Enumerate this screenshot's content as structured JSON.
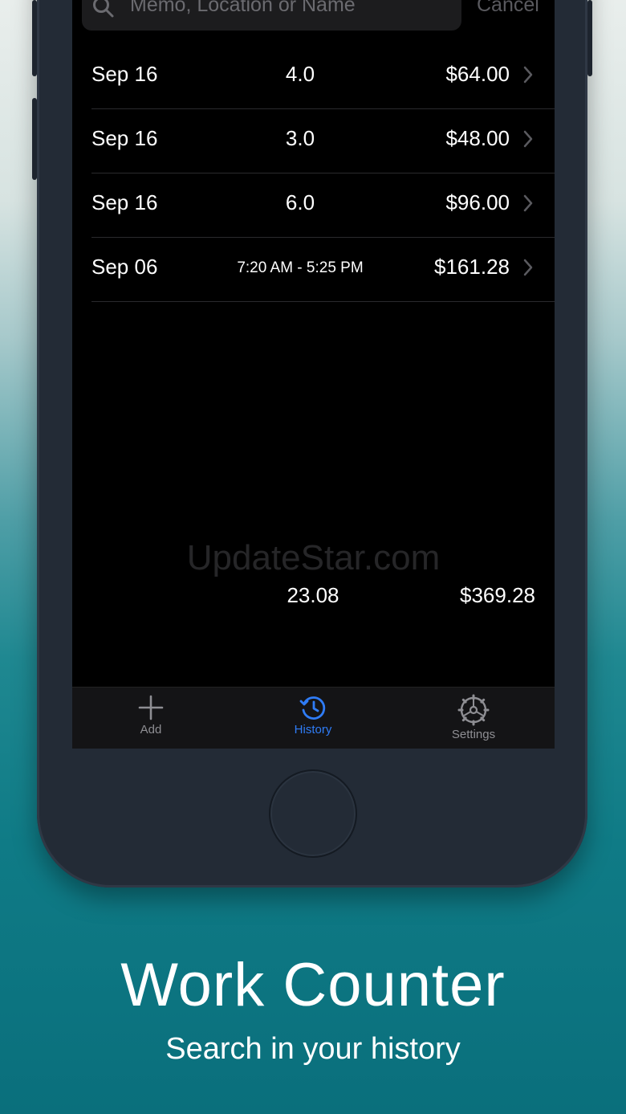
{
  "search": {
    "placeholder": "Memo, Location or Name",
    "cancel_label": "Cancel"
  },
  "entries": [
    {
      "date": "Sep 16",
      "hours": "4.0",
      "amount": "$64.00"
    },
    {
      "date": "Sep 16",
      "hours": "3.0",
      "amount": "$48.00"
    },
    {
      "date": "Sep 16",
      "hours": "6.0",
      "amount": "$96.00"
    },
    {
      "date": "Sep 06",
      "hours": "7:20 AM - 5:25 PM",
      "amount": "$161.28"
    }
  ],
  "watermark": "UpdateStar.com",
  "totals": {
    "hours": "23.08",
    "amount": "$369.28"
  },
  "tabs": [
    {
      "label": "Add",
      "icon": "plus-icon",
      "active": false
    },
    {
      "label": "History",
      "icon": "history-clock-icon",
      "active": true
    },
    {
      "label": "Settings",
      "icon": "settings-gear-icon",
      "active": false
    }
  ],
  "colors": {
    "accent": "#2f7cf6",
    "inactive": "#8e8e93"
  },
  "marketing": {
    "title": "Work Counter",
    "subtitle": "Search in your history"
  }
}
